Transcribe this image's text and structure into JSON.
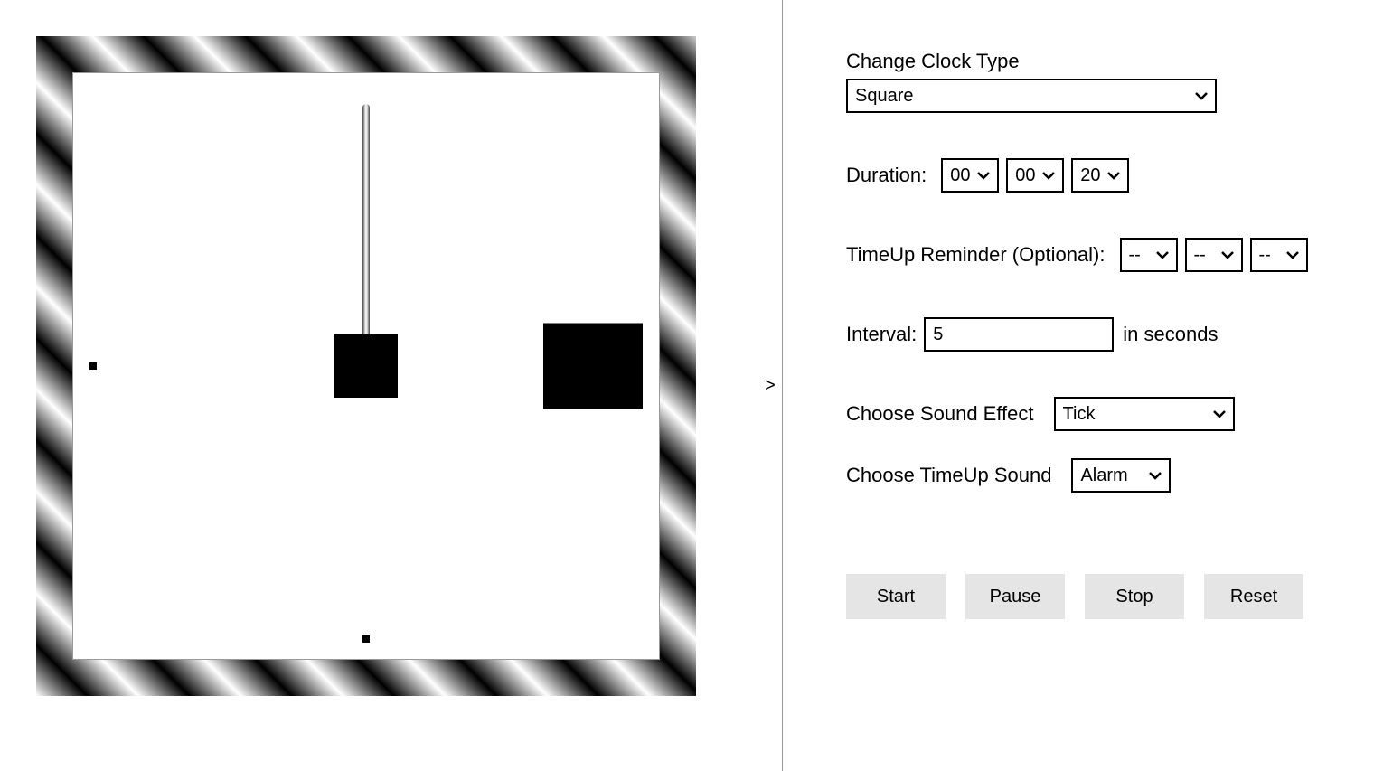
{
  "panel": {
    "toggle_arrow": ">",
    "clock_type_label": "Change Clock Type",
    "clock_type_value": "Square",
    "duration_label": "Duration:",
    "duration": {
      "hours": "00",
      "minutes": "00",
      "seconds": "20"
    },
    "timeup_label": "TimeUp Reminder (Optional):",
    "timeup": {
      "hours": "--",
      "minutes": "--",
      "seconds": "--"
    },
    "interval_label": "Interval:",
    "interval_value": "5",
    "interval_unit": "in seconds",
    "sound_effect_label": "Choose Sound Effect",
    "sound_effect_value": "Tick",
    "timeup_sound_label": "Choose TimeUp Sound",
    "timeup_sound_value": "Alarm",
    "buttons": {
      "start": "Start",
      "pause": "Pause",
      "stop": "Stop",
      "reset": "Reset"
    }
  }
}
